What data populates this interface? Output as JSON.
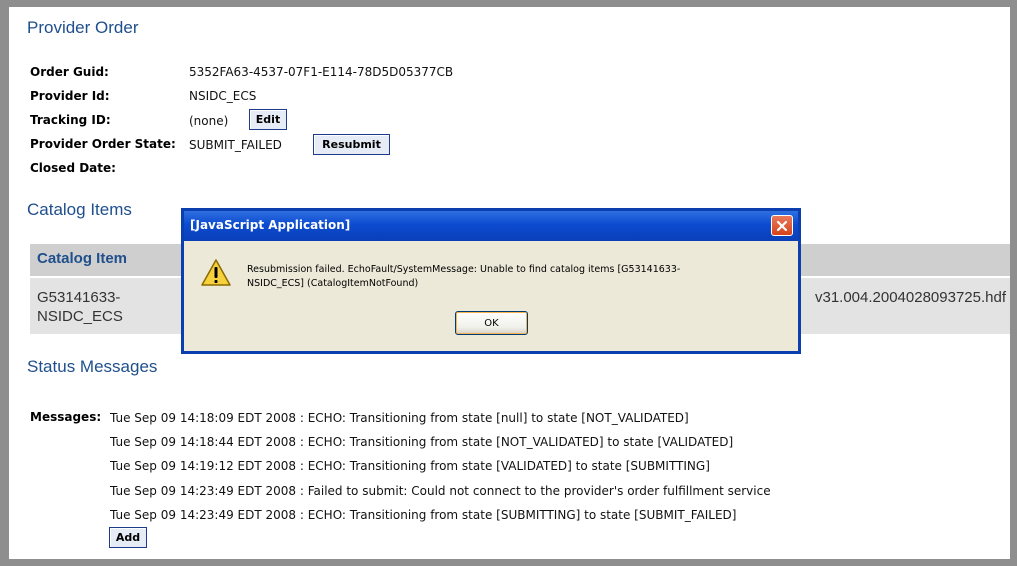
{
  "provider_order": {
    "title": "Provider Order",
    "fields": {
      "order_guid_label": "Order Guid:",
      "order_guid_value": "5352FA63-4537-07F1-E114-78D5D05377CB",
      "provider_id_label": "Provider Id:",
      "provider_id_value": "NSIDC_ECS",
      "tracking_id_label": "Tracking ID:",
      "tracking_id_value": "(none)",
      "provider_state_label": "Provider Order State:",
      "provider_state_value": "SUBMIT_FAILED",
      "closed_date_label": "Closed Date:"
    },
    "edit_label": "Edit",
    "resubmit_label": "Resubmit"
  },
  "catalog_items": {
    "title": "Catalog Items",
    "column_header": "Catalog Item",
    "row": {
      "id": "G53141633-NSIDC_ECS",
      "file": "v31.004.2004028093725.hdf"
    }
  },
  "status_messages": {
    "title": "Status Messages",
    "label": "Messages:",
    "lines": [
      "Tue Sep 09 14:18:09 EDT 2008 : ECHO: Transitioning from state [null] to state [NOT_VALIDATED]",
      "Tue Sep 09 14:18:44 EDT 2008 : ECHO: Transitioning from state [NOT_VALIDATED] to state [VALIDATED]",
      "Tue Sep 09 14:19:12 EDT 2008 : ECHO: Transitioning from state [VALIDATED] to state [SUBMITTING]",
      "Tue Sep 09 14:23:49 EDT 2008 : Failed to submit: Could not connect to the provider's order fulfillment service",
      "Tue Sep 09 14:23:49 EDT 2008 : ECHO: Transitioning from state [SUBMITTING] to state [SUBMIT_FAILED]"
    ],
    "add_label": "Add"
  },
  "dialog": {
    "title": "[JavaScript Application]",
    "message": "Resubmission failed. EchoFault/SystemMessage: Unable to find catalog items [G53141633-NSIDC_ECS] (CatalogItemNotFound)",
    "ok_label": "OK",
    "icon": "warning-icon",
    "close_icon": "close-icon"
  },
  "colors": {
    "section_title": "#1f4f8c",
    "frame": "#8e8e8e",
    "dialog_title_bar": "#0c4bd0",
    "dialog_body": "#ece9d8"
  }
}
